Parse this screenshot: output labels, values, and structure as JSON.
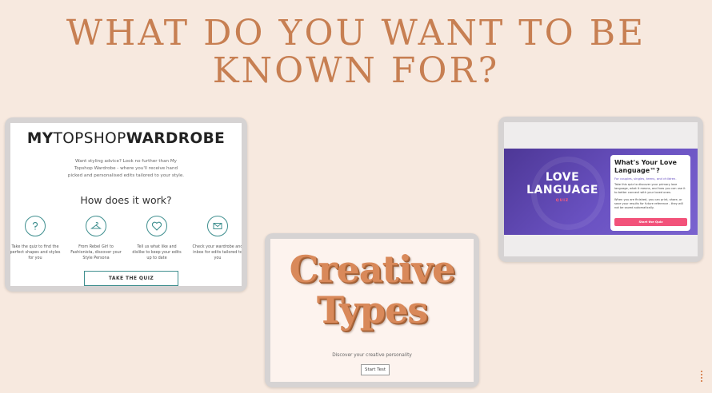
{
  "headline": {
    "line1": "WHAT DO YOU WANT TO BE",
    "line2": "KNOWN FOR?"
  },
  "topshop": {
    "logo_part1": "MY",
    "logo_part2": "TOPSHOP",
    "logo_part3": "WARDROBE",
    "intro": "Want styling advice? Look no further than My Topshop Wardrobe - where you'll receive hand picked and personalised edits tailored to your style.",
    "how_title": "How does it work?",
    "steps": [
      {
        "icon": "question-icon",
        "text": "Take the quiz to find the perfect shapes and styles for you"
      },
      {
        "icon": "hanger-icon",
        "text": "From Rebel Girl to Fashionista, discover your Style Persona"
      },
      {
        "icon": "heart-icon",
        "text": "Tell us what like and dislike to keep your edits up to date"
      },
      {
        "icon": "mail-icon",
        "text": "Check your wardrobe and inbox for edits tailored to you"
      }
    ],
    "button": "TAKE THE QUIZ",
    "accent": "#3f8f8f"
  },
  "creative": {
    "title_line1": "Creative",
    "title_line2": "Types",
    "subtitle": "Discover your creative personality",
    "button": "Start Test"
  },
  "love": {
    "logo_line1": "LOVE",
    "logo_line2": "LANGUAGE",
    "logo_tag": "QUIZ",
    "card_title": "What's Your Love Language™?",
    "card_link": "For couples, singles, teens, and children.",
    "card_text1": "Take this quiz to discover your primary love language, what it means, and how you can use it to better connect with your loved ones.",
    "card_text2": "When you are finished, you can print, share, or save your results for future reference - they will not be saved automatically.",
    "button": "Start the Quiz",
    "accent": "#f2527a"
  }
}
